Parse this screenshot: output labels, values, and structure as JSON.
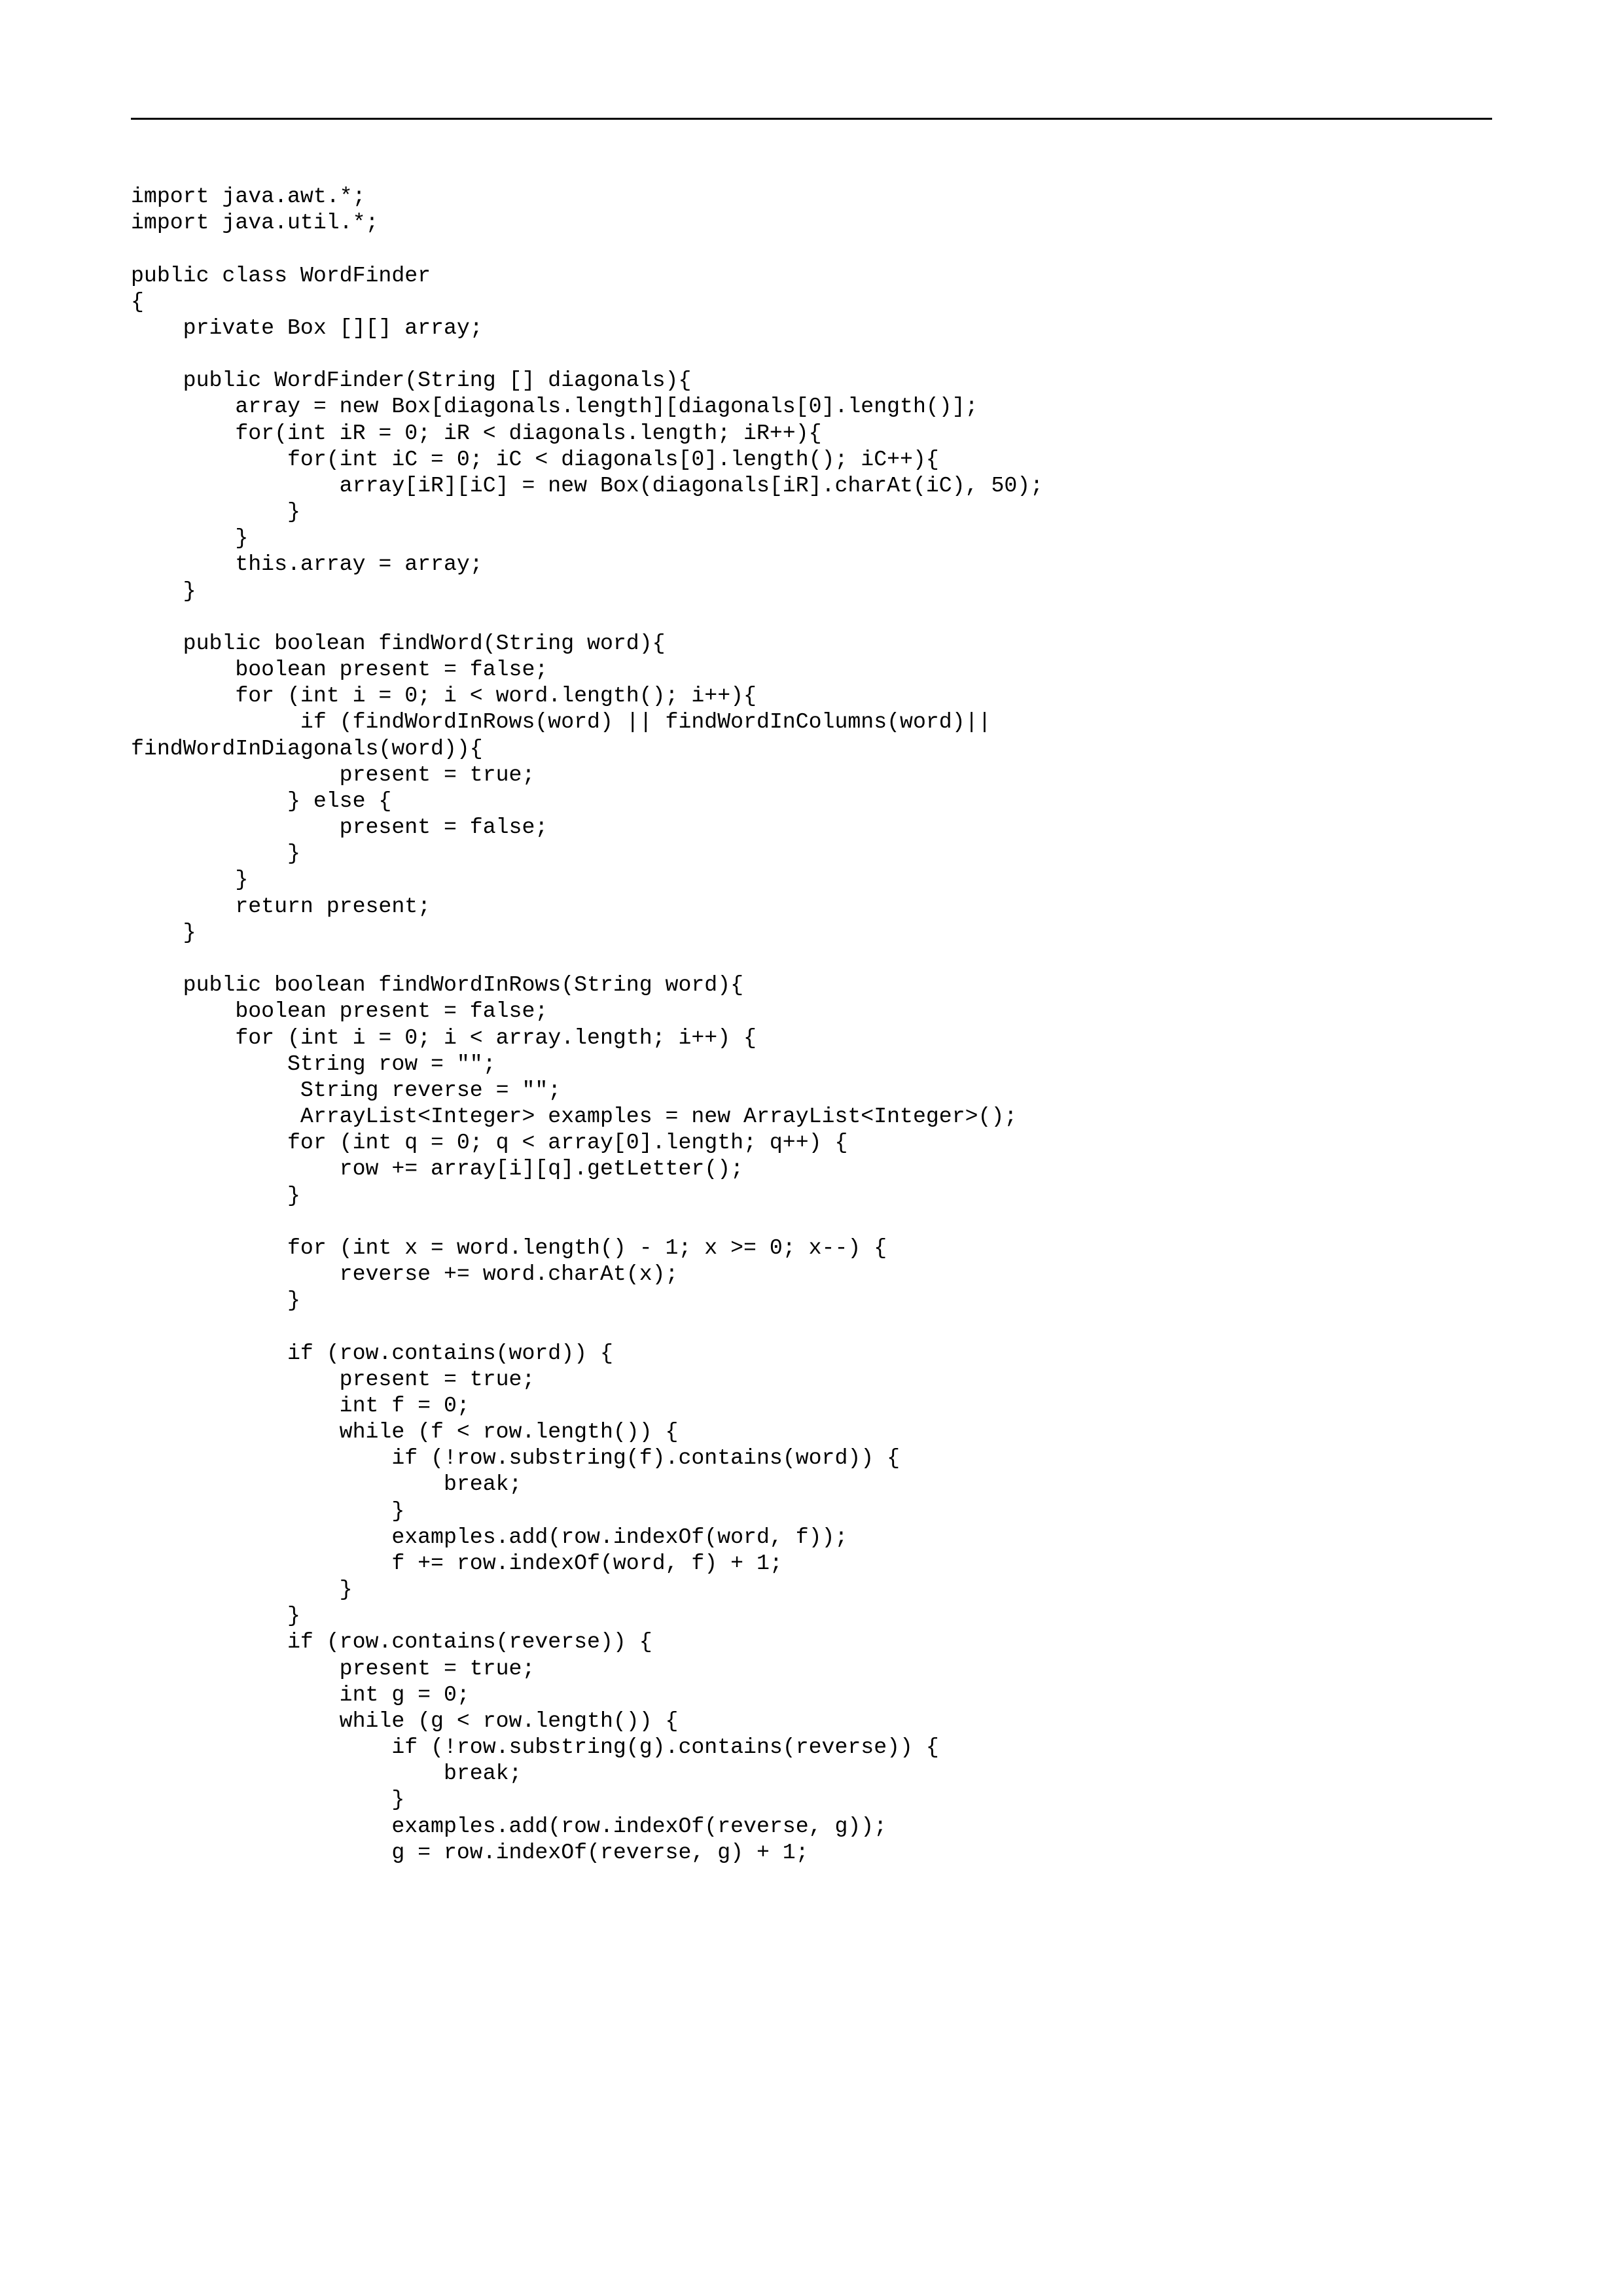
{
  "code_lines": [
    "import java.awt.*;",
    "import java.util.*;",
    "",
    "public class WordFinder",
    "{",
    "    private Box [][] array;",
    "",
    "    public WordFinder(String [] diagonals){",
    "        array = new Box[diagonals.length][diagonals[0].length()];",
    "        for(int iR = 0; iR < diagonals.length; iR++){",
    "            for(int iC = 0; iC < diagonals[0].length(); iC++){",
    "                array[iR][iC] = new Box(diagonals[iR].charAt(iC), 50);",
    "            }",
    "        }",
    "        this.array = array;",
    "    }",
    "",
    "    public boolean findWord(String word){",
    "        boolean present = false;",
    "        for (int i = 0; i < word.length(); i++){",
    "             if (findWordInRows(word) || findWordInColumns(word)||",
    "findWordInDiagonals(word)){",
    "                present = true;",
    "            } else {",
    "                present = false;",
    "            }",
    "        }",
    "        return present;",
    "    }",
    "",
    "    public boolean findWordInRows(String word){",
    "        boolean present = false;",
    "        for (int i = 0; i < array.length; i++) {",
    "            String row = \"\";",
    "             String reverse = \"\";",
    "             ArrayList<Integer> examples = new ArrayList<Integer>();",
    "            for (int q = 0; q < array[0].length; q++) {",
    "                row += array[i][q].getLetter();",
    "            }",
    "",
    "            for (int x = word.length() - 1; x >= 0; x--) {",
    "                reverse += word.charAt(x);",
    "            }",
    "",
    "            if (row.contains(word)) {",
    "                present = true;",
    "                int f = 0;",
    "                while (f < row.length()) {",
    "                    if (!row.substring(f).contains(word)) {",
    "                        break;",
    "                    }",
    "                    examples.add(row.indexOf(word, f));",
    "                    f += row.indexOf(word, f) + 1;",
    "                }",
    "            }",
    "            if (row.contains(reverse)) {",
    "                present = true;",
    "                int g = 0;",
    "                while (g < row.length()) {",
    "                    if (!row.substring(g).contains(reverse)) {",
    "                        break;",
    "                    }",
    "                    examples.add(row.indexOf(reverse, g));",
    "                    g = row.indexOf(reverse, g) + 1;"
  ]
}
